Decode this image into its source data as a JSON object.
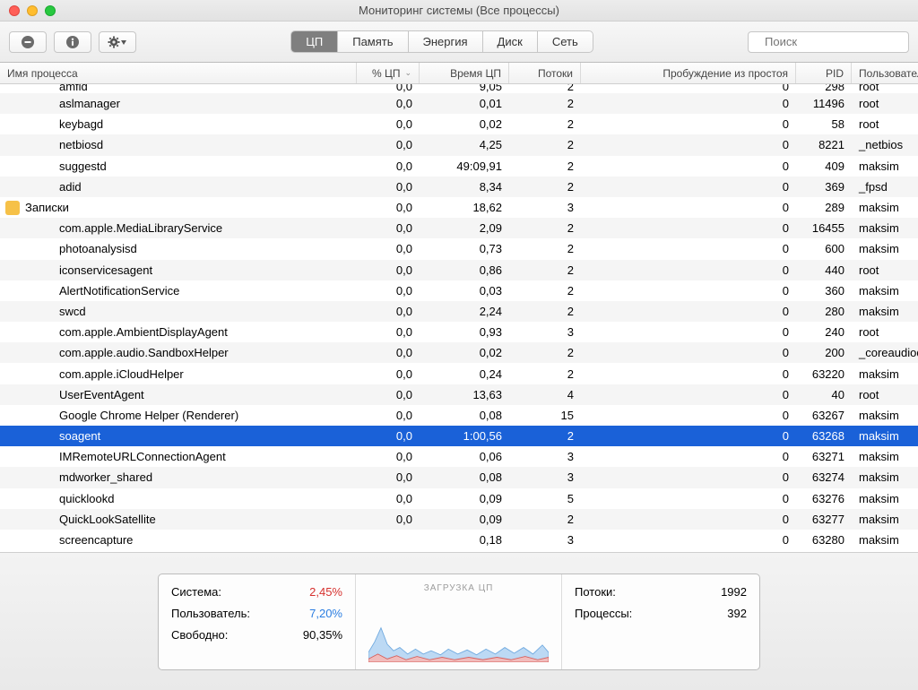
{
  "window_title": "Мониторинг системы (Все процессы)",
  "search": {
    "placeholder": "Поиск"
  },
  "tabs": {
    "cpu": "ЦП",
    "memory": "Память",
    "energy": "Энергия",
    "disk": "Диск",
    "network": "Сеть"
  },
  "columns": {
    "name": "Имя процесса",
    "cpu": "% ЦП",
    "time": "Время ЦП",
    "threads": "Потоки",
    "wake": "Пробуждение из простоя",
    "pid": "PID",
    "user": "Пользователь"
  },
  "rows": [
    {
      "name": "amfid",
      "cpu": "0,0",
      "time": "9,05",
      "thr": "2",
      "wake": "0",
      "pid": "298",
      "user": "root",
      "cut": true,
      "alt": false
    },
    {
      "name": "aslmanager",
      "cpu": "0,0",
      "time": "0,01",
      "thr": "2",
      "wake": "0",
      "pid": "11496",
      "user": "root",
      "alt": true
    },
    {
      "name": "keybagd",
      "cpu": "0,0",
      "time": "0,02",
      "thr": "2",
      "wake": "0",
      "pid": "58",
      "user": "root",
      "alt": false
    },
    {
      "name": "netbiosd",
      "cpu": "0,0",
      "time": "4,25",
      "thr": "2",
      "wake": "0",
      "pid": "8221",
      "user": "_netbios",
      "alt": true
    },
    {
      "name": "suggestd",
      "cpu": "0,0",
      "time": "49:09,91",
      "thr": "2",
      "wake": "0",
      "pid": "409",
      "user": "maksim",
      "alt": false
    },
    {
      "name": "adid",
      "cpu": "0,0",
      "time": "8,34",
      "thr": "2",
      "wake": "0",
      "pid": "369",
      "user": "_fpsd",
      "alt": true
    },
    {
      "name": "Записки",
      "cpu": "0,0",
      "time": "18,62",
      "thr": "3",
      "wake": "0",
      "pid": "289",
      "user": "maksim",
      "alt": false,
      "icon": "#f6c148"
    },
    {
      "name": "com.apple.MediaLibraryService",
      "cpu": "0,0",
      "time": "2,09",
      "thr": "2",
      "wake": "0",
      "pid": "16455",
      "user": "maksim",
      "alt": true
    },
    {
      "name": "photoanalysisd",
      "cpu": "0,0",
      "time": "0,73",
      "thr": "2",
      "wake": "0",
      "pid": "600",
      "user": "maksim",
      "alt": false
    },
    {
      "name": "iconservicesagent",
      "cpu": "0,0",
      "time": "0,86",
      "thr": "2",
      "wake": "0",
      "pid": "440",
      "user": "root",
      "alt": true
    },
    {
      "name": "AlertNotificationService",
      "cpu": "0,0",
      "time": "0,03",
      "thr": "2",
      "wake": "0",
      "pid": "360",
      "user": "maksim",
      "alt": false
    },
    {
      "name": "swcd",
      "cpu": "0,0",
      "time": "2,24",
      "thr": "2",
      "wake": "0",
      "pid": "280",
      "user": "maksim",
      "alt": true
    },
    {
      "name": "com.apple.AmbientDisplayAgent",
      "cpu": "0,0",
      "time": "0,93",
      "thr": "3",
      "wake": "0",
      "pid": "240",
      "user": "root",
      "alt": false
    },
    {
      "name": "com.apple.audio.SandboxHelper",
      "cpu": "0,0",
      "time": "0,02",
      "thr": "2",
      "wake": "0",
      "pid": "200",
      "user": "_coreaudiod",
      "alt": true
    },
    {
      "name": "com.apple.iCloudHelper",
      "cpu": "0,0",
      "time": "0,24",
      "thr": "2",
      "wake": "0",
      "pid": "63220",
      "user": "maksim",
      "alt": false
    },
    {
      "name": "UserEventAgent",
      "cpu": "0,0",
      "time": "13,63",
      "thr": "4",
      "wake": "0",
      "pid": "40",
      "user": "root",
      "alt": true
    },
    {
      "name": "Google Chrome Helper (Renderer)",
      "cpu": "0,0",
      "time": "0,08",
      "thr": "15",
      "wake": "0",
      "pid": "63267",
      "user": "maksim",
      "alt": false
    },
    {
      "name": "soagent",
      "cpu": "0,0",
      "time": "1:00,56",
      "thr": "2",
      "wake": "0",
      "pid": "63268",
      "user": "maksim",
      "alt": true,
      "selected": true
    },
    {
      "name": "IMRemoteURLConnectionAgent",
      "cpu": "0,0",
      "time": "0,06",
      "thr": "3",
      "wake": "0",
      "pid": "63271",
      "user": "maksim",
      "alt": false
    },
    {
      "name": "mdworker_shared",
      "cpu": "0,0",
      "time": "0,08",
      "thr": "3",
      "wake": "0",
      "pid": "63274",
      "user": "maksim",
      "alt": true
    },
    {
      "name": "quicklookd",
      "cpu": "0,0",
      "time": "0,09",
      "thr": "5",
      "wake": "0",
      "pid": "63276",
      "user": "maksim",
      "alt": false
    },
    {
      "name": "QuickLookSatellite",
      "cpu": "0,0",
      "time": "0,09",
      "thr": "2",
      "wake": "0",
      "pid": "63277",
      "user": "maksim",
      "alt": true
    },
    {
      "name": "screencapture",
      "cpu": "",
      "time": "0,18",
      "thr": "3",
      "wake": "0",
      "pid": "63280",
      "user": "maksim",
      "alt": false
    }
  ],
  "stats": {
    "system_label": "Система:",
    "system_val": "2,45%",
    "user_label": "Пользователь:",
    "user_val": "7,20%",
    "idle_label": "Свободно:",
    "idle_val": "90,35%",
    "chart_title": "ЗАГРУЗКА ЦП",
    "threads_label": "Потоки:",
    "threads_val": "1992",
    "procs_label": "Процессы:",
    "procs_val": "392"
  }
}
